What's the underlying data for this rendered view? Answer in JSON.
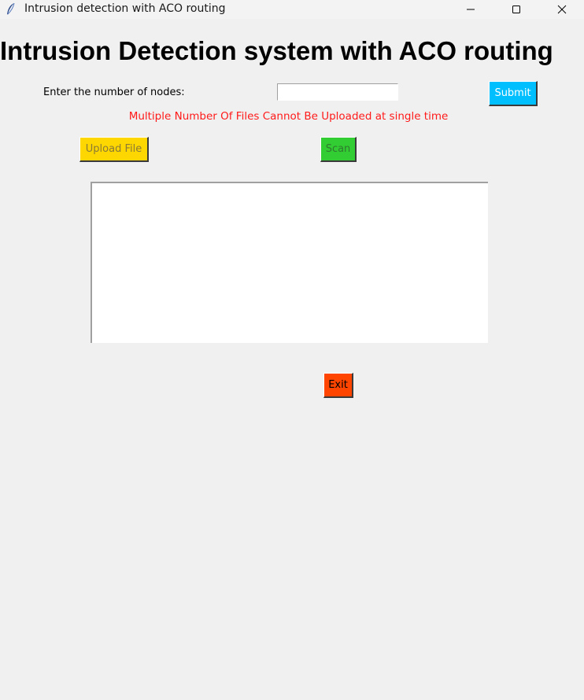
{
  "window": {
    "title": "Intrusion detection with ACO routing",
    "icon": "feather-icon"
  },
  "heading": "Intrusion Detection system with ACO routing",
  "nodes": {
    "label": "Enter the number of nodes:",
    "value": "",
    "placeholder": ""
  },
  "buttons": {
    "submit": "Submit",
    "upload": "Upload File",
    "scan": "Scan",
    "exit": "Exit"
  },
  "warning": "Multiple Number Of Files Cannot Be Uploaded at single time",
  "output": {
    "text": ""
  },
  "colors": {
    "submit": "#00bfff",
    "upload": "#ffd700",
    "scan": "#32cd32",
    "exit": "#ff4500",
    "warning": "#ff1a1a",
    "background": "#f0f0f0"
  }
}
